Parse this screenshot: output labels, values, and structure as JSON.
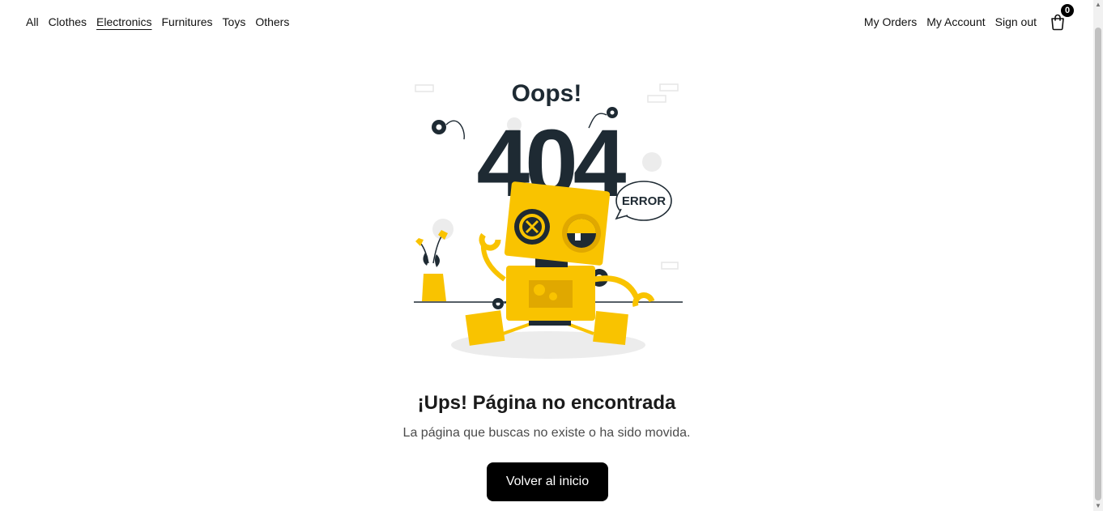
{
  "nav": {
    "categories": [
      {
        "label": "All"
      },
      {
        "label": "Clothes"
      },
      {
        "label": "Electronics",
        "active": true
      },
      {
        "label": "Furnitures"
      },
      {
        "label": "Toys"
      },
      {
        "label": "Others"
      }
    ],
    "account": {
      "orders": "My Orders",
      "account": "My Account",
      "signout": "Sign out"
    },
    "cart_count": "0"
  },
  "illustration": {
    "oops": "Oops!",
    "code": "404",
    "error": "ERROR"
  },
  "content": {
    "title": "¡Ups! Página no encontrada",
    "subtitle": "La página que buscas no existe o ha sido movida.",
    "button": "Volver al inicio"
  },
  "colors": {
    "accent_yellow": "#F9C300",
    "dark": "#1E2A33",
    "button": "#000000"
  }
}
